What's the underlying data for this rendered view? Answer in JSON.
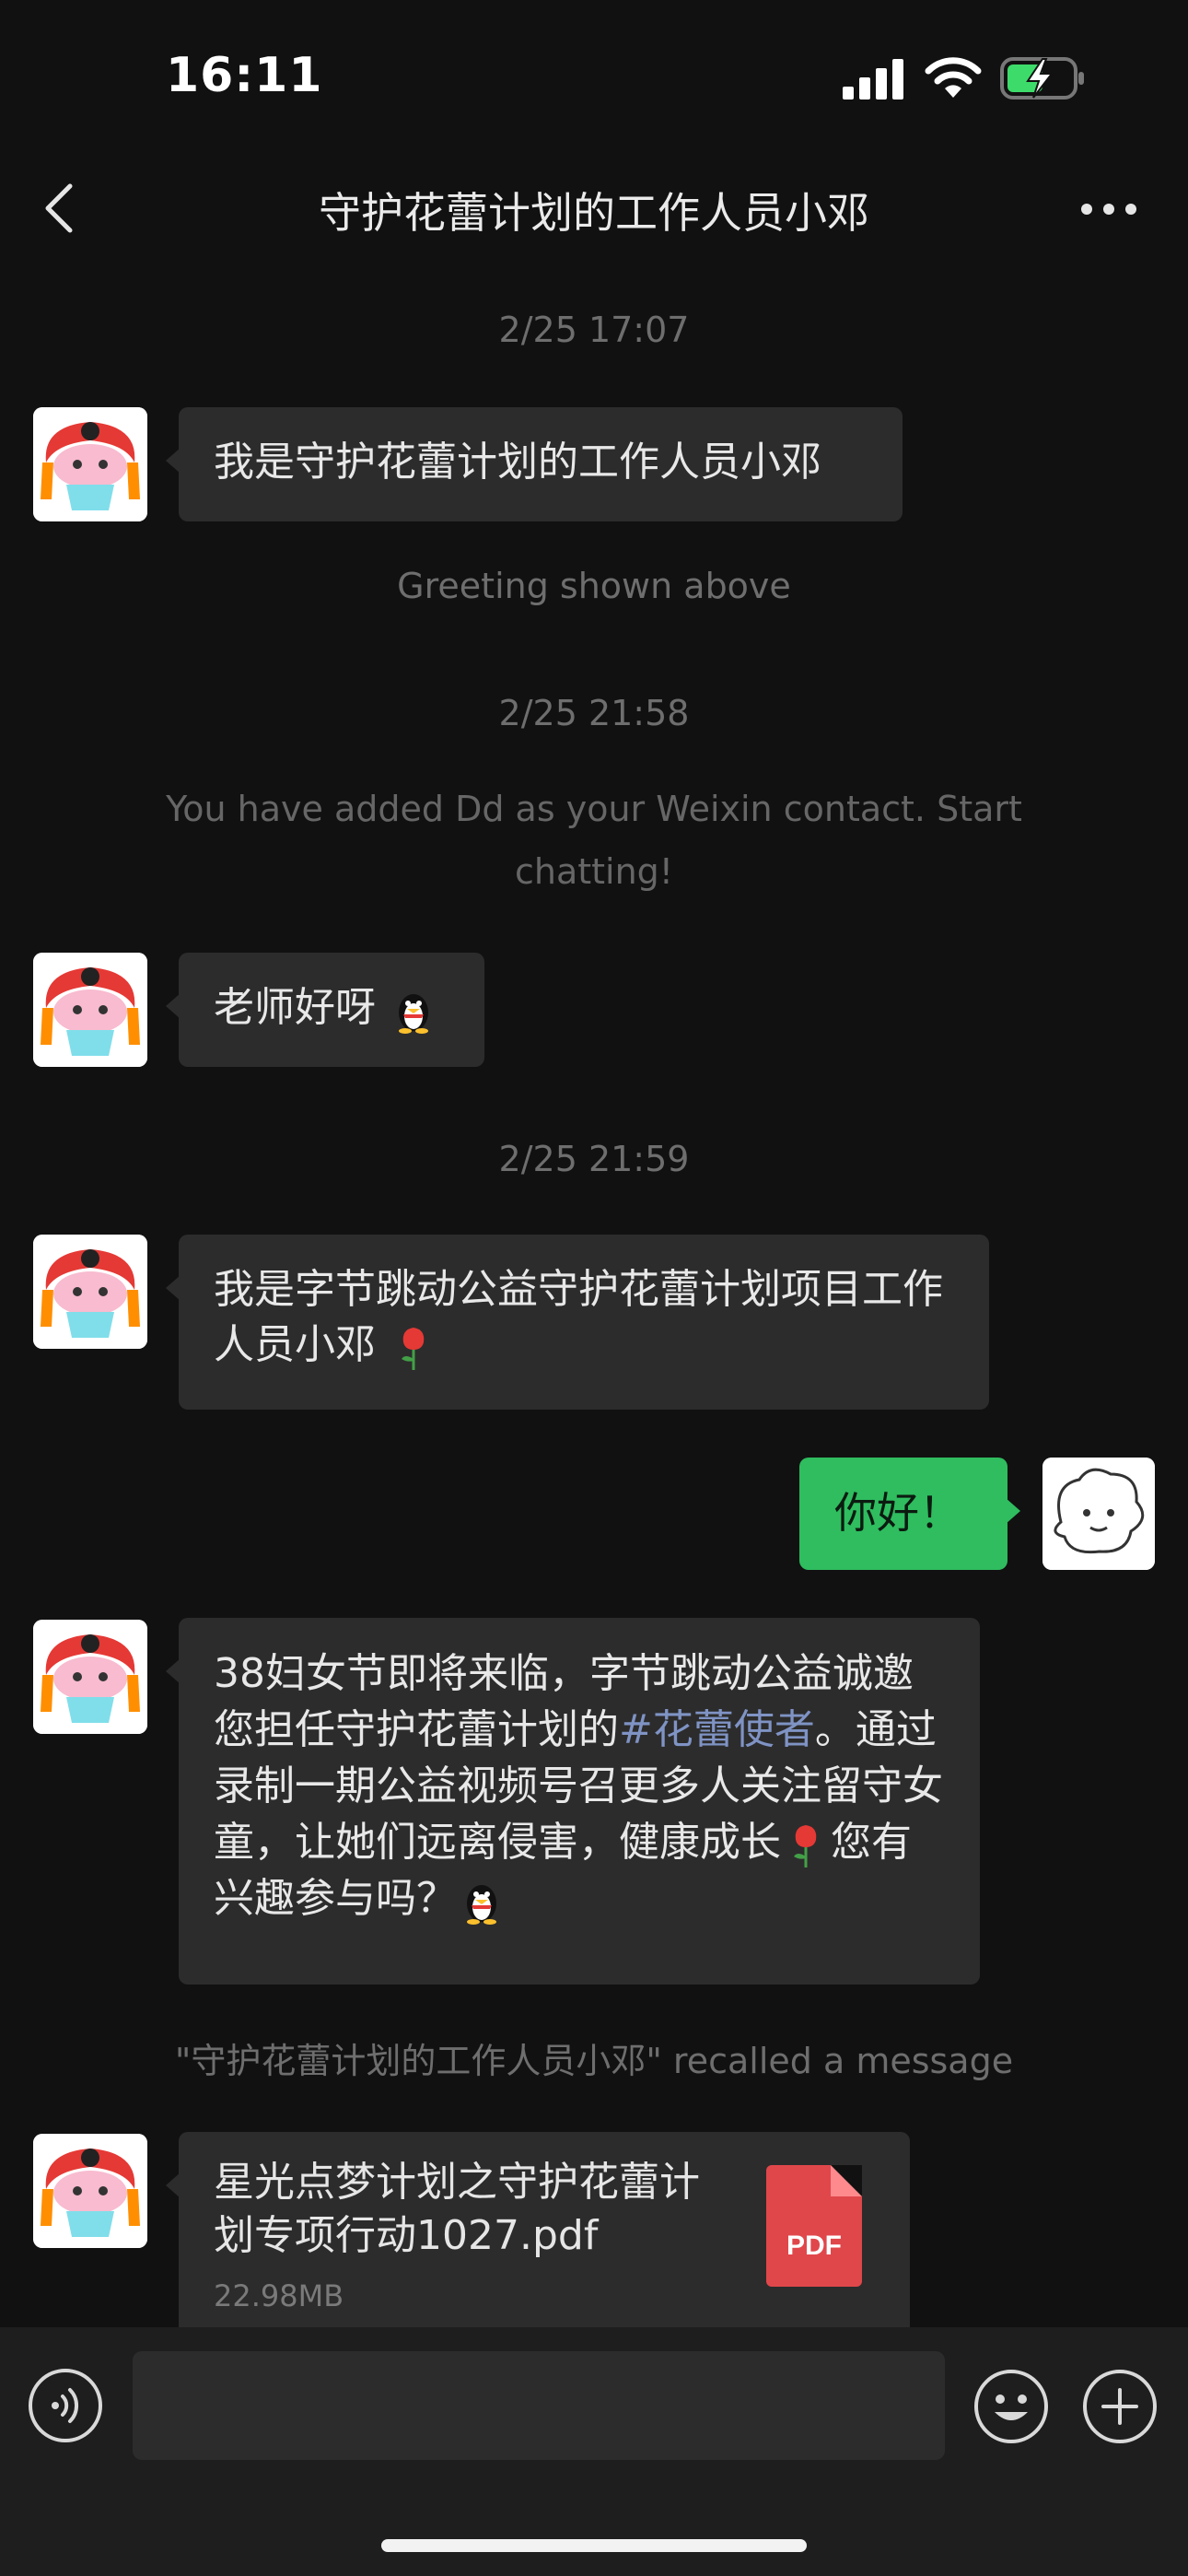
{
  "status_bar": {
    "time": "16:11",
    "battery": "charging"
  },
  "nav": {
    "title": "守护花蕾计划的工作人员小邓",
    "back_icon": "chevron-left-icon",
    "more_icon": "more-horizontal-icon"
  },
  "messages": {
    "ts1": "2/25 17:07",
    "m1": "我是守护花蕾计划的工作人员小邓",
    "greeting_note": "Greeting shown above",
    "ts2": "2/25 21:58",
    "added_note": "You have added Dd as your Weixin contact. Start chatting!",
    "m2": "老师好呀",
    "ts3": "2/25 21:59",
    "m3": "我是字节跳动公益守护花蕾计划项目工作人员小邓",
    "m4": "你好！",
    "m5_part1": "38妇女节即将来临，字节跳动公益诚邀您担任守护花蕾计划的",
    "m5_link": "#花蕾使者",
    "m5_part2": "。通过录制一期公益视频号召更多人关注留守女童，让她们远离侵害，健康成长",
    "m5_part3": "您有兴趣参与吗？",
    "recall_note": "\"守护花蕾计划的工作人员小邓\" recalled a message",
    "file": {
      "name": "星光点梦计划之守护花蕾计划专项行动1027.pdf",
      "size": "22.98MB",
      "type_label": "PDF"
    }
  },
  "input_bar": {
    "voice_icon": "voice-icon",
    "emoji_icon": "emoji-icon",
    "plus_icon": "plus-icon"
  },
  "colors": {
    "background": "#111111",
    "bubble_in": "#2c2c2c",
    "bubble_out": "#2fbd5f",
    "link": "#7f93c4",
    "pdf": "#e0474b"
  }
}
